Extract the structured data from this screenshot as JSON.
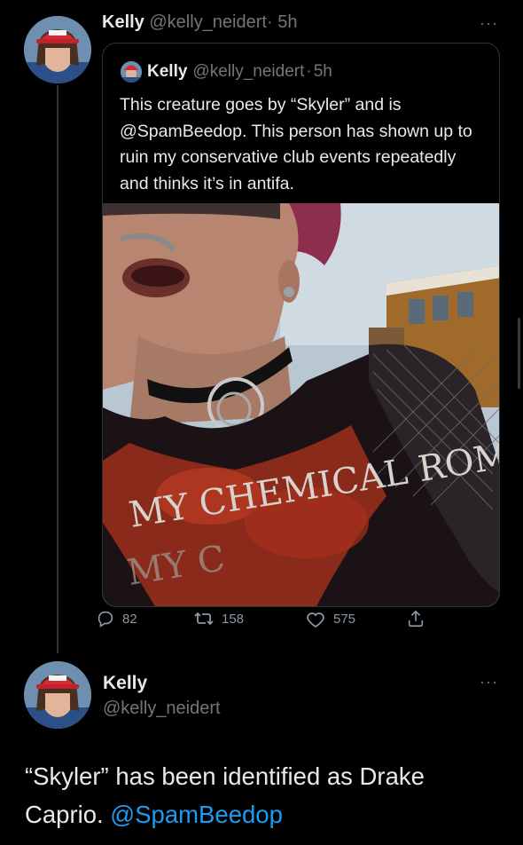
{
  "tweet1": {
    "author_name": "Kelly",
    "handle": "@kelly_neidert",
    "separator": "·",
    "time": "5h",
    "more": "···"
  },
  "quoted": {
    "author_name": "Kelly",
    "handle": "@kelly_neidert",
    "separator": "·",
    "time": "5h",
    "text": "This creature goes by “Skyler” and is @SpamBeedop. This person has shown up to ruin my conservative club events repeatedly and thinks it’s in antifa.",
    "photo": {
      "shirt_text": "MY CHEMICAL ROMANCE"
    }
  },
  "actions": {
    "replies": "82",
    "retweets": "158",
    "likes": "575"
  },
  "tweet2": {
    "author_name": "Kelly",
    "handle": "@kelly_neidert",
    "more": "···",
    "text_before": "“Skyler” has been identified as Drake Caprio. ",
    "mention": "@SpamBeedop"
  },
  "icons": {
    "reply": "reply-icon",
    "retweet": "retweet-icon",
    "like": "heart-icon",
    "share": "share-icon"
  },
  "colors": {
    "background": "#000000",
    "text": "#e7e9ea",
    "muted": "#71767b",
    "link": "#1d9bf0",
    "border": "#2f3336"
  }
}
